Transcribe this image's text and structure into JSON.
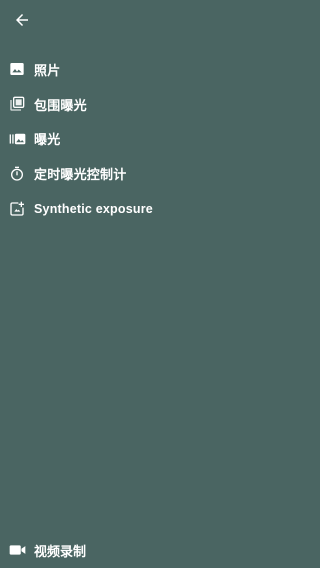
{
  "header": {
    "back_icon": "arrow-left-icon"
  },
  "menu": {
    "items": [
      {
        "label": "照片",
        "icon": "photo-icon"
      },
      {
        "label": "包围曝光",
        "icon": "bracket-exposure-icon"
      },
      {
        "label": "曝光",
        "icon": "exposure-icon"
      },
      {
        "label": "定时曝光控制计",
        "icon": "timer-icon"
      },
      {
        "label": "Synthetic exposure",
        "icon": "synthetic-exposure-icon"
      }
    ]
  },
  "footer": {
    "video_label": "视频录制",
    "video_icon": "video-camera-icon"
  },
  "colors": {
    "background": "#4a6562",
    "foreground": "#ffffff"
  }
}
